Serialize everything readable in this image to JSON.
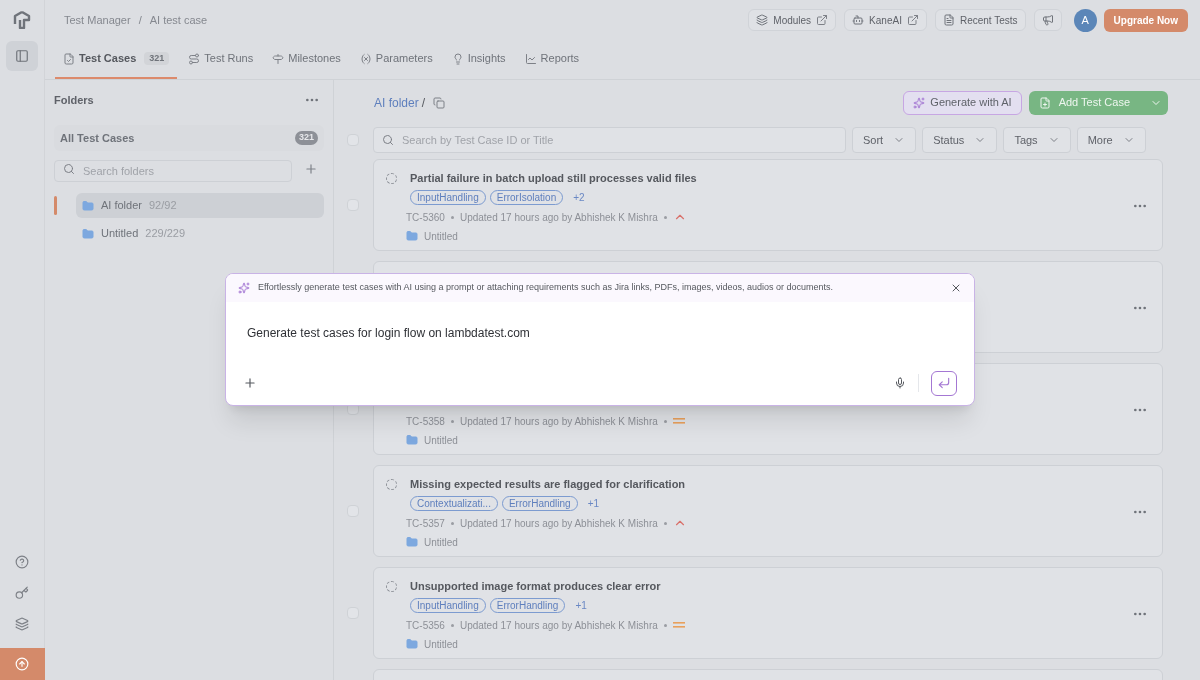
{
  "breadcrumb": [
    "Test Manager",
    "AI test case"
  ],
  "breadcrumb_separator": "/",
  "header_buttons": [
    {
      "kind": "modules",
      "label": "Modules"
    },
    {
      "kind": "kaneai",
      "label": "KaneAI"
    },
    {
      "kind": "recent",
      "label": "Recent Tests"
    },
    {
      "kind": "announce"
    }
  ],
  "avatar": "A",
  "upgrade": "Upgrade Now",
  "tabs": [
    {
      "kind": "cases",
      "label": "Test Cases",
      "count": "321",
      "selected": true
    },
    {
      "kind": "runs",
      "label": "Test Runs",
      "selected": false
    },
    {
      "kind": "milestones",
      "label": "Milestones",
      "selected": false
    },
    {
      "kind": "parameters",
      "label": "Parameters",
      "selected": false
    },
    {
      "kind": "insights",
      "label": "Insights",
      "selected": false
    },
    {
      "kind": "reports",
      "label": "Reports",
      "selected": false
    }
  ],
  "folders": {
    "title": "Folders",
    "all_label": "All Test Cases",
    "all_count": "321",
    "search_placeholder": "Search folders",
    "items": [
      {
        "name": "AI folder",
        "count": "92/92",
        "selected": true
      },
      {
        "name": "Untitled",
        "count": "229/229",
        "selected": false
      }
    ]
  },
  "content": {
    "path": "AI folder",
    "separator": "/",
    "generate_button": "Generate with AI",
    "add_button": "Add Test Case",
    "search_placeholder": "Search by Test Case ID or Title",
    "select_all_checked": false,
    "filters": [
      "Sort",
      "Status",
      "Tags",
      "More"
    ],
    "cards": [
      {
        "kind": "full",
        "checked": false,
        "title": "Partial failure in batch upload still processes valid files",
        "tags": [
          "InputHandling",
          "ErrorIsolation"
        ],
        "more_tags": "+2",
        "id": "TC-5360",
        "updated": "Updated 17 hours ago by Abhishek K Mishra",
        "priority": {
          "kind": "high"
        },
        "folder": "Untitled"
      },
      {
        "kind": "covered"
      },
      {
        "kind": "partial",
        "checked": false,
        "id": "TC-5358",
        "updated": "Updated 17 hours ago by Abhishek K Mishra",
        "priority": {
          "kind": "medium"
        },
        "folder": "Untitled"
      },
      {
        "kind": "full",
        "checked": false,
        "title": "Missing expected results are flagged for clarification",
        "tags": [
          "Contextualizati...",
          "ErrorHandling"
        ],
        "more_tags": "+1",
        "id": "TC-5357",
        "updated": "Updated 17 hours ago by Abhishek K Mishra",
        "priority": {
          "kind": "high"
        },
        "folder": "Untitled"
      },
      {
        "kind": "full",
        "checked": false,
        "title": "Unsupported image format produces clear error",
        "tags": [
          "InputHandling",
          "ErrorHandling"
        ],
        "more_tags": "+1",
        "id": "TC-5356",
        "updated": "Updated 17 hours ago by Abhishek K Mishra",
        "priority": {
          "kind": "medium"
        },
        "folder": "Untitled"
      },
      {
        "kind": "cut"
      }
    ]
  },
  "dialog": {
    "hint": "Effortlessly generate test cases with AI using a prompt or attaching requirements such as Jira links, PDFs, images, videos, audios or documents.",
    "prompt": "Generate test cases for login flow on lambdatest.com"
  }
}
